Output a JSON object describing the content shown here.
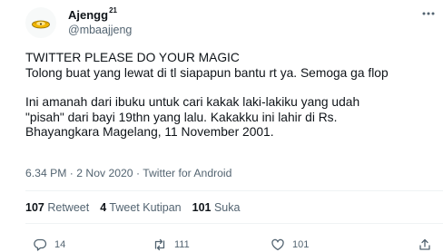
{
  "user": {
    "display_name": "Ajengg",
    "name_superscript": "21",
    "handle": "@mbaajjeng"
  },
  "tweet": {
    "lines": [
      "TWITTER PLEASE DO YOUR MAGIC",
      "Tolong buat yang lewat di tl siapapun bantu rt ya. Semoga ga flop",
      "Ini amanah dari ibuku untuk cari kakak laki-lakiku yang udah",
      "\"pisah\" dari bayi 19thn yang lalu. Kakakku ini lahir di Rs.",
      "Bhayangkara Magelang, 11 November 2001."
    ],
    "time": "6.34 PM",
    "date": "2 Nov 2020",
    "separator": "·",
    "source": "Twitter for Android"
  },
  "stats": {
    "retweets_count": "107",
    "retweets_label": "Retweet",
    "quotes_count": "4",
    "quotes_label": "Tweet Kutipan",
    "likes_count": "101",
    "likes_label": "Suka"
  },
  "actions": {
    "reply_count": "14",
    "retweet_count": "111",
    "like_count": "101",
    "icons": [
      "reply-icon",
      "retweet-icon",
      "like-icon",
      "share-icon"
    ]
  },
  "colors": {
    "text_primary": "#0f1419",
    "text_secondary": "#536471",
    "divider": "#eff3f4",
    "avatar_accent": "#f2b705"
  }
}
